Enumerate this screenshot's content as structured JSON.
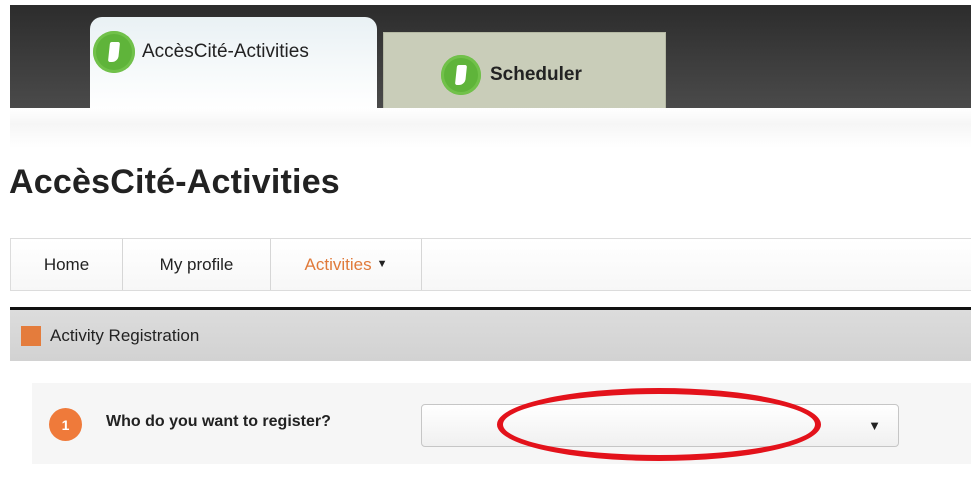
{
  "tabs": [
    {
      "label": "AccèsCité-Activities",
      "icon": "app-logo-icon",
      "active": true
    },
    {
      "label": "Scheduler",
      "icon": "app-logo-icon",
      "active": false
    }
  ],
  "page": {
    "title": "AccèsCité-Activities"
  },
  "nav": {
    "items": [
      {
        "label": "Home"
      },
      {
        "label": "My profile"
      },
      {
        "label": "Activities",
        "has_dropdown": true,
        "caret": "▼"
      }
    ]
  },
  "section": {
    "title": "Activity Registration",
    "icon": "orange-square-icon"
  },
  "form": {
    "step_number": "1",
    "question": "Who do you want to register?",
    "select_value": "",
    "select_caret": "▼"
  },
  "colors": {
    "accent_orange": "#ef7a3a",
    "logo_green": "#5fb43a",
    "annotation_red": "#e3121b",
    "tab_bar_dark": "#3a3a3a",
    "inactive_tab": "#c9cdb9"
  }
}
